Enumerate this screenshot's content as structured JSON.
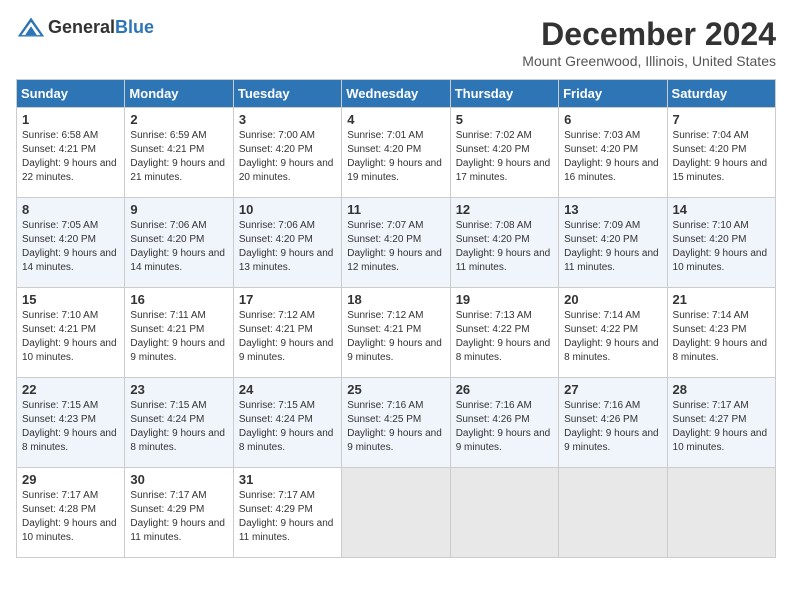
{
  "logo": {
    "general": "General",
    "blue": "Blue"
  },
  "title": "December 2024",
  "subtitle": "Mount Greenwood, Illinois, United States",
  "headers": [
    "Sunday",
    "Monday",
    "Tuesday",
    "Wednesday",
    "Thursday",
    "Friday",
    "Saturday"
  ],
  "weeks": [
    [
      {
        "day": "1",
        "sunrise": "6:58 AM",
        "sunset": "4:21 PM",
        "daylight": "9 hours and 22 minutes."
      },
      {
        "day": "2",
        "sunrise": "6:59 AM",
        "sunset": "4:21 PM",
        "daylight": "9 hours and 21 minutes."
      },
      {
        "day": "3",
        "sunrise": "7:00 AM",
        "sunset": "4:20 PM",
        "daylight": "9 hours and 20 minutes."
      },
      {
        "day": "4",
        "sunrise": "7:01 AM",
        "sunset": "4:20 PM",
        "daylight": "9 hours and 19 minutes."
      },
      {
        "day": "5",
        "sunrise": "7:02 AM",
        "sunset": "4:20 PM",
        "daylight": "9 hours and 17 minutes."
      },
      {
        "day": "6",
        "sunrise": "7:03 AM",
        "sunset": "4:20 PM",
        "daylight": "9 hours and 16 minutes."
      },
      {
        "day": "7",
        "sunrise": "7:04 AM",
        "sunset": "4:20 PM",
        "daylight": "9 hours and 15 minutes."
      }
    ],
    [
      {
        "day": "8",
        "sunrise": "7:05 AM",
        "sunset": "4:20 PM",
        "daylight": "9 hours and 14 minutes."
      },
      {
        "day": "9",
        "sunrise": "7:06 AM",
        "sunset": "4:20 PM",
        "daylight": "9 hours and 14 minutes."
      },
      {
        "day": "10",
        "sunrise": "7:06 AM",
        "sunset": "4:20 PM",
        "daylight": "9 hours and 13 minutes."
      },
      {
        "day": "11",
        "sunrise": "7:07 AM",
        "sunset": "4:20 PM",
        "daylight": "9 hours and 12 minutes."
      },
      {
        "day": "12",
        "sunrise": "7:08 AM",
        "sunset": "4:20 PM",
        "daylight": "9 hours and 11 minutes."
      },
      {
        "day": "13",
        "sunrise": "7:09 AM",
        "sunset": "4:20 PM",
        "daylight": "9 hours and 11 minutes."
      },
      {
        "day": "14",
        "sunrise": "7:10 AM",
        "sunset": "4:20 PM",
        "daylight": "9 hours and 10 minutes."
      }
    ],
    [
      {
        "day": "15",
        "sunrise": "7:10 AM",
        "sunset": "4:21 PM",
        "daylight": "9 hours and 10 minutes."
      },
      {
        "day": "16",
        "sunrise": "7:11 AM",
        "sunset": "4:21 PM",
        "daylight": "9 hours and 9 minutes."
      },
      {
        "day": "17",
        "sunrise": "7:12 AM",
        "sunset": "4:21 PM",
        "daylight": "9 hours and 9 minutes."
      },
      {
        "day": "18",
        "sunrise": "7:12 AM",
        "sunset": "4:21 PM",
        "daylight": "9 hours and 9 minutes."
      },
      {
        "day": "19",
        "sunrise": "7:13 AM",
        "sunset": "4:22 PM",
        "daylight": "9 hours and 8 minutes."
      },
      {
        "day": "20",
        "sunrise": "7:14 AM",
        "sunset": "4:22 PM",
        "daylight": "9 hours and 8 minutes."
      },
      {
        "day": "21",
        "sunrise": "7:14 AM",
        "sunset": "4:23 PM",
        "daylight": "9 hours and 8 minutes."
      }
    ],
    [
      {
        "day": "22",
        "sunrise": "7:15 AM",
        "sunset": "4:23 PM",
        "daylight": "9 hours and 8 minutes."
      },
      {
        "day": "23",
        "sunrise": "7:15 AM",
        "sunset": "4:24 PM",
        "daylight": "9 hours and 8 minutes."
      },
      {
        "day": "24",
        "sunrise": "7:15 AM",
        "sunset": "4:24 PM",
        "daylight": "9 hours and 8 minutes."
      },
      {
        "day": "25",
        "sunrise": "7:16 AM",
        "sunset": "4:25 PM",
        "daylight": "9 hours and 9 minutes."
      },
      {
        "day": "26",
        "sunrise": "7:16 AM",
        "sunset": "4:26 PM",
        "daylight": "9 hours and 9 minutes."
      },
      {
        "day": "27",
        "sunrise": "7:16 AM",
        "sunset": "4:26 PM",
        "daylight": "9 hours and 9 minutes."
      },
      {
        "day": "28",
        "sunrise": "7:17 AM",
        "sunset": "4:27 PM",
        "daylight": "9 hours and 10 minutes."
      }
    ],
    [
      {
        "day": "29",
        "sunrise": "7:17 AM",
        "sunset": "4:28 PM",
        "daylight": "9 hours and 10 minutes."
      },
      {
        "day": "30",
        "sunrise": "7:17 AM",
        "sunset": "4:29 PM",
        "daylight": "9 hours and 11 minutes."
      },
      {
        "day": "31",
        "sunrise": "7:17 AM",
        "sunset": "4:29 PM",
        "daylight": "9 hours and 11 minutes."
      },
      null,
      null,
      null,
      null
    ]
  ],
  "labels": {
    "sunrise": "Sunrise:",
    "sunset": "Sunset:",
    "daylight": "Daylight:"
  }
}
